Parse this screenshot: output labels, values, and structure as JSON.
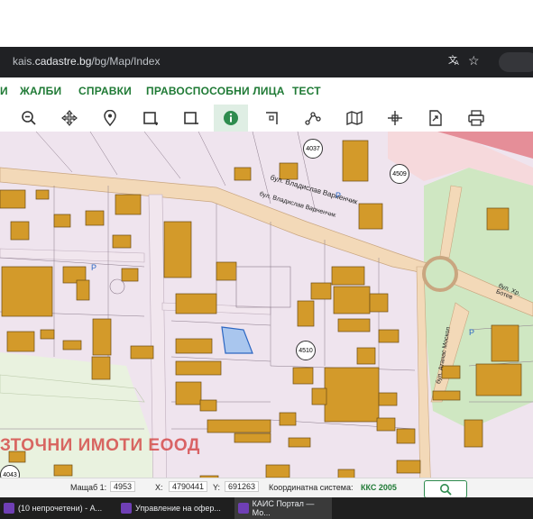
{
  "browser": {
    "url_prefix": "kais.",
    "url_domain": "cadastre.bg",
    "url_path": "/bg/Map/Index",
    "translate_icon": "translate-icon",
    "bookmark_icon": "star-icon"
  },
  "menu": {
    "items": [
      "ЖАЛБИ",
      "СПРАВКИ",
      "ПРАВОСПОСОБНИ ЛИЦА",
      "ТЕСТ"
    ]
  },
  "toolbar": {
    "tools": [
      "zoom-out-icon",
      "pan-icon",
      "locate-pin-icon",
      "select-rectangle-icon",
      "deselect-rectangle-icon",
      "info-icon",
      "measure-icon",
      "route-icon",
      "map-layers-icon",
      "crosshair-icon",
      "export-icon",
      "print-icon"
    ],
    "active_tool": "info-icon"
  },
  "map": {
    "street_label": "бул. Владислав Варненчик",
    "street_label_2": "бул. Владислав Варненчик",
    "street_label_3": "бул. Хр. Ботев",
    "street_label_4": "бул. Атанас Москоп",
    "block_labels": [
      "4037",
      "4509",
      "4510",
      "4043"
    ],
    "parking_label": "P",
    "watermark": "ЗТОЧНИ ИМОТИ ЕООД"
  },
  "status": {
    "scale_label": "Мащаб 1:",
    "scale_value": "4953",
    "x_label": "X:",
    "x_value": "4790441",
    "y_label": "Y:",
    "y_value": "691263",
    "crs_label": "Координатна система:",
    "crs_value": "ККС 2005"
  },
  "taskbar": {
    "items": [
      {
        "label": "(10 непрочетени) - А..."
      },
      {
        "label": "Управление на офер..."
      },
      {
        "label": "КАИС Портал — Мо..."
      }
    ]
  },
  "colors": {
    "menu_green": "#1f7a35",
    "building": "#d39a2a",
    "selected_parcel": "#a9c6ee",
    "park": "#cfe7c2",
    "road": "#f3d9b8",
    "watermark": "#d23737"
  }
}
